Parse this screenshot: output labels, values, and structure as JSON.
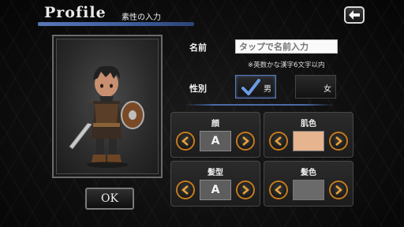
{
  "header": {
    "title": "Profile",
    "subtitle": "素性の入力"
  },
  "profile": {
    "name_label": "名前",
    "name_placeholder": "タップで名前入力",
    "name_hint": "※英数かな漢字6文字以内",
    "gender_label": "性別",
    "gender_male": "男",
    "gender_female": "女",
    "gender_selected": "男"
  },
  "options": {
    "face": {
      "title": "顔",
      "value": "A"
    },
    "skin": {
      "title": "肌色",
      "color": "#e6b48e"
    },
    "hair": {
      "title": "髪型",
      "value": "A"
    },
    "hair_color": {
      "title": "髪色",
      "color": "#6a6a6a"
    }
  },
  "ok_label": "OK",
  "colors": {
    "accent_blue": "#4d6aa6",
    "arrow_ring": "#c47a1c"
  }
}
